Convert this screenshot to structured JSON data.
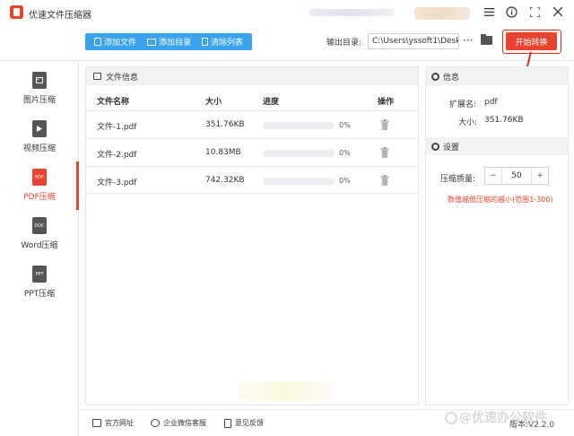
{
  "window": {
    "title": "优速文件压缩器",
    "controls": [
      "menu-icon",
      "info-icon",
      "maximize-icon",
      "close-icon"
    ]
  },
  "toolbar": {
    "add_file": "添加文件",
    "add_folder": "添加目录",
    "clear_list": "清除列表",
    "output_label": "输出目录:",
    "output_path": "C:\\Users\\yssoft1\\Deskt",
    "more": "···",
    "start": "开始转换"
  },
  "sidebar": {
    "items": [
      {
        "label": "图片压缩",
        "icon": "image-file-icon"
      },
      {
        "label": "视频压缩",
        "icon": "video-file-icon"
      },
      {
        "label": "PDF压缩",
        "icon": "pdf-file-icon",
        "badge": "PDF"
      },
      {
        "label": "Word压缩",
        "icon": "word-file-icon",
        "badge": "DOC"
      },
      {
        "label": "PPT压缩",
        "icon": "ppt-file-icon",
        "badge": "PPT"
      }
    ],
    "active_index": 2,
    "accent_color": "#e8432e"
  },
  "files_panel": {
    "title": "文件信息",
    "columns": {
      "name": "文件名称",
      "size": "大小",
      "progress": "进度",
      "action": "操作"
    },
    "rows": [
      {
        "name": "文件-1.pdf",
        "size": "351.76KB",
        "progress": 0,
        "progress_text": "0%"
      },
      {
        "name": "文件-2.pdf",
        "size": "10.83MB",
        "progress": 0,
        "progress_text": "0%"
      },
      {
        "name": "文件-3.pdf",
        "size": "742.32KB",
        "progress": 0,
        "progress_text": "0%"
      }
    ]
  },
  "info_panel": {
    "title": "信息",
    "ext_label": "扩展名:",
    "ext_value": "pdf",
    "size_label": "大小:",
    "size_value": "351.76KB"
  },
  "settings_panel": {
    "title": "设置",
    "quality_label": "压缩质量:",
    "quality_value": "50",
    "minus": "−",
    "plus": "+",
    "hint": "数值越低压缩的越小(范围1-300)"
  },
  "footer": {
    "website": "官方网址",
    "wechat": "企业微信客服",
    "feedback": "意见反馈",
    "watermark": "@优速办公软件",
    "version": "版本:V2.2.0"
  },
  "colors": {
    "primary_blue": "#3aa3ec",
    "accent_red": "#e8432e",
    "panel_header": "#f1f2f4"
  }
}
